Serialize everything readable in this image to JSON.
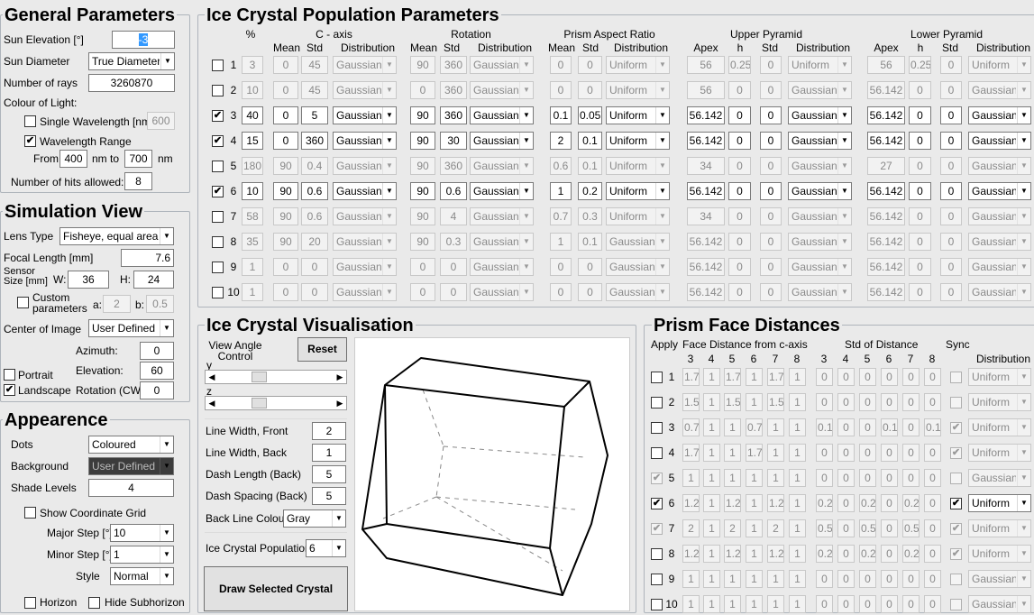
{
  "general": {
    "title": "General Parameters",
    "sun_elevation_label": "Sun Elevation [°]",
    "sun_elevation": "-3",
    "sun_diameter_label": "Sun Diameter",
    "sun_diameter": "True Diameter",
    "num_rays_label": "Number of rays",
    "num_rays": "3260870",
    "colour_label": "Colour of Light:",
    "single_wl_label": "Single Wavelength [nm]",
    "single_wl": "600",
    "single_wl_checked": "",
    "wl_range_label": "Wavelength Range",
    "wl_range_checked": "✔",
    "from_label": "From",
    "from": "400",
    "nm_to_label": "nm to",
    "to": "700",
    "nm_label": "nm",
    "hits_label": "Number of hits allowed:",
    "hits": "8"
  },
  "simview": {
    "title": "Simulation View",
    "lens_label": "Lens Type",
    "lens": "Fisheye, equal area",
    "focal_label": "Focal Length [mm]",
    "focal": "7.6",
    "sensor_label1": "Sensor",
    "sensor_label2": "Size [mm]",
    "w_label": "W:",
    "w": "36",
    "h_label": "H:",
    "h": "24",
    "custom_label1": "Custom",
    "custom_label2": "parameters",
    "custom_checked": "",
    "a_label": "a:",
    "a": "2",
    "b_label": "b:",
    "b": "0.5",
    "center_label": "Center of Image",
    "center": "User Defined",
    "azimuth_label": "Azimuth:",
    "azimuth": "0",
    "elevation_label": "Elevation:",
    "elevation": "60",
    "rotation_label": "Rotation (CW)",
    "rotation": "0",
    "portrait_label": "Portrait",
    "portrait_checked": "",
    "landscape_label": "Landscape",
    "landscape_checked": "✔"
  },
  "appearance": {
    "title": "Appearence",
    "dots_label": "Dots",
    "dots": "Coloured",
    "bg_label": "Background",
    "bg": "User Defined",
    "shade_label": "Shade Levels",
    "shade": "4",
    "grid_label": "Show Coordinate Grid",
    "grid_checked": "",
    "major_label": "Major Step [°]",
    "major": "10",
    "minor_label": "Minor Step [°]",
    "minor": "1",
    "style_label": "Style",
    "style": "Normal",
    "horizon_label": "Horizon",
    "hide_sub_label": "Hide Subhorizon"
  },
  "population": {
    "title": "Ice Crystal Population Parameters",
    "groups": {
      "pct": "%",
      "caxis": "C - axis",
      "rotation": "Rotation",
      "prism": "Prism Aspect Ratio",
      "upper": "Upper Pyramid",
      "lower": "Lower Pyramid"
    },
    "sub": {
      "mean": "Mean",
      "std": "Std",
      "dist": "Distribution",
      "apex": "Apex",
      "h": "h"
    },
    "rows": [
      {
        "n": "1",
        "chk": "",
        "pct": "3",
        "cm": "0",
        "cs": "45",
        "cd": "Gaussian",
        "rm": "90",
        "rs": "360",
        "rd": "Gaussian",
        "pm": "0",
        "ps": "0",
        "pd": "Uniform",
        "ua": "56",
        "uh": "0.25",
        "us": "0",
        "ud": "Uniform",
        "la": "56",
        "lh": "0.25",
        "ls": "0",
        "ld": "Uniform"
      },
      {
        "n": "2",
        "chk": "",
        "pct": "10",
        "cm": "0",
        "cs": "45",
        "cd": "Gaussian",
        "rm": "0",
        "rs": "360",
        "rd": "Gaussian",
        "pm": "0",
        "ps": "0",
        "pd": "Uniform",
        "ua": "56",
        "uh": "0",
        "us": "0",
        "ud": "Gaussian",
        "la": "56.142",
        "lh": "0",
        "ls": "0",
        "ld": "Gaussian"
      },
      {
        "n": "3",
        "chk": "✔",
        "pct": "40",
        "cm": "0",
        "cs": "5",
        "cd": "Gaussian",
        "rm": "90",
        "rs": "360",
        "rd": "Gaussian",
        "pm": "0.1",
        "ps": "0.05",
        "pd": "Uniform",
        "ua": "56.142",
        "uh": "0",
        "us": "0",
        "ud": "Gaussian",
        "la": "56.142",
        "lh": "0",
        "ls": "0",
        "ld": "Gaussian"
      },
      {
        "n": "4",
        "chk": "✔",
        "pct": "15",
        "cm": "0",
        "cs": "360",
        "cd": "Gaussian",
        "rm": "90",
        "rs": "30",
        "rd": "Gaussian",
        "pm": "2",
        "ps": "0.1",
        "pd": "Uniform",
        "ua": "56.142",
        "uh": "0",
        "us": "0",
        "ud": "Gaussian",
        "la": "56.142",
        "lh": "0",
        "ls": "0",
        "ld": "Gaussian"
      },
      {
        "n": "5",
        "chk": "",
        "pct": "180",
        "cm": "90",
        "cs": "0.4",
        "cd": "Gaussian",
        "rm": "90",
        "rs": "360",
        "rd": "Gaussian",
        "pm": "0.6",
        "ps": "0.1",
        "pd": "Uniform",
        "ua": "34",
        "uh": "0",
        "us": "0",
        "ud": "Gaussian",
        "la": "27",
        "lh": "0",
        "ls": "0",
        "ld": "Gaussian"
      },
      {
        "n": "6",
        "chk": "✔",
        "pct": "10",
        "cm": "90",
        "cs": "0.6",
        "cd": "Gaussian",
        "rm": "90",
        "rs": "0.6",
        "rd": "Gaussian",
        "pm": "1",
        "ps": "0.2",
        "pd": "Uniform",
        "ua": "56.142",
        "uh": "0",
        "us": "0",
        "ud": "Gaussian",
        "la": "56.142",
        "lh": "0",
        "ls": "0",
        "ld": "Gaussian"
      },
      {
        "n": "7",
        "chk": "",
        "pct": "58",
        "cm": "90",
        "cs": "0.6",
        "cd": "Gaussian",
        "rm": "90",
        "rs": "4",
        "rd": "Gaussian",
        "pm": "0.7",
        "ps": "0.3",
        "pd": "Uniform",
        "ua": "34",
        "uh": "0",
        "us": "0",
        "ud": "Gaussian",
        "la": "56.142",
        "lh": "0",
        "ls": "0",
        "ld": "Gaussian"
      },
      {
        "n": "8",
        "chk": "",
        "pct": "35",
        "cm": "90",
        "cs": "20",
        "cd": "Gaussian",
        "rm": "90",
        "rs": "0.3",
        "rd": "Gaussian",
        "pm": "1",
        "ps": "0.1",
        "pd": "Gaussian",
        "ua": "56.142",
        "uh": "0",
        "us": "0",
        "ud": "Gaussian",
        "la": "56.142",
        "lh": "0",
        "ls": "0",
        "ld": "Gaussian"
      },
      {
        "n": "9",
        "chk": "",
        "pct": "1",
        "cm": "0",
        "cs": "0",
        "cd": "Gaussian",
        "rm": "0",
        "rs": "0",
        "rd": "Gaussian",
        "pm": "0",
        "ps": "0",
        "pd": "Gaussian",
        "ua": "56.142",
        "uh": "0",
        "us": "0",
        "ud": "Gaussian",
        "la": "56.142",
        "lh": "0",
        "ls": "0",
        "ld": "Gaussian"
      },
      {
        "n": "10",
        "chk": "",
        "pct": "1",
        "cm": "0",
        "cs": "0",
        "cd": "Gaussian",
        "rm": "0",
        "rs": "0",
        "rd": "Gaussian",
        "pm": "0",
        "ps": "0",
        "pd": "Gaussian",
        "ua": "56.142",
        "uh": "0",
        "us": "0",
        "ud": "Gaussian",
        "la": "56.142",
        "lh": "0",
        "ls": "0",
        "ld": "Gaussian"
      }
    ]
  },
  "vis": {
    "title": "Ice Crystal Visualisation",
    "view_label1": "View Angle",
    "view_label2": "Control",
    "reset": "Reset",
    "y_label": "y",
    "z_label": "z",
    "lw_front_label": "Line Width, Front",
    "lw_front": "2",
    "lw_back_label": "Line Width, Back",
    "lw_back": "1",
    "dash_len_label": "Dash Length (Back)",
    "dash_len": "5",
    "dash_sp_label": "Dash Spacing (Back)",
    "dash_sp": "5",
    "back_col_label": "Back Line Colour",
    "back_col": "Gray",
    "pop_label": "Ice Crystal Population",
    "pop": "6",
    "draw": "Draw Selected Crystal",
    "y_slider": 0.33,
    "z_slider": 0.33
  },
  "prism": {
    "title": "Prism Face Distances",
    "apply": "Apply",
    "face_dist": "Face Distance from c-axis",
    "std_dist": "Std of Distance",
    "sync": "Sync",
    "distribution": "Distribution",
    "faces": [
      "3",
      "4",
      "5",
      "6",
      "7",
      "8"
    ],
    "rows": [
      {
        "n": "1",
        "apply": "",
        "fd": [
          "1.7",
          "1",
          "1.7",
          "1",
          "1.7",
          "1"
        ],
        "sd": [
          "0",
          "0",
          "0",
          "0",
          "0",
          "0"
        ],
        "sync": "",
        "sync_dis": false,
        "dist": "Uniform"
      },
      {
        "n": "2",
        "apply": "",
        "fd": [
          "1.5",
          "1",
          "1.5",
          "1",
          "1.5",
          "1"
        ],
        "sd": [
          "0",
          "0",
          "0",
          "0",
          "0",
          "0"
        ],
        "sync": "",
        "sync_dis": false,
        "dist": "Uniform"
      },
      {
        "n": "3",
        "apply": "",
        "fd": [
          "0.7",
          "1",
          "1",
          "0.7",
          "1",
          "1"
        ],
        "sd": [
          "0.1",
          "0",
          "0",
          "0.1",
          "0",
          "0.1"
        ],
        "sync": "✔",
        "sync_dis": true,
        "dist": "Uniform"
      },
      {
        "n": "4",
        "apply": "",
        "fd": [
          "1.7",
          "1",
          "1",
          "1.7",
          "1",
          "1"
        ],
        "sd": [
          "0",
          "0",
          "0",
          "0",
          "0",
          "0"
        ],
        "sync": "✔",
        "sync_dis": true,
        "dist": "Uniform"
      },
      {
        "n": "5",
        "apply": "✔",
        "fd": [
          "1",
          "1",
          "1",
          "1",
          "1",
          "1"
        ],
        "sd": [
          "0",
          "0",
          "0",
          "0",
          "0",
          "0"
        ],
        "sync": "",
        "sync_dis": false,
        "dist": "Gaussian"
      },
      {
        "n": "6",
        "apply": "✔",
        "fd": [
          "1.2",
          "1",
          "1.2",
          "1",
          "1.2",
          "1"
        ],
        "sd": [
          "0.2",
          "0",
          "0.2",
          "0",
          "0.2",
          "0"
        ],
        "sync": "✔",
        "sync_dis": false,
        "dist": "Uniform"
      },
      {
        "n": "7",
        "apply": "✔",
        "fd": [
          "2",
          "1",
          "2",
          "1",
          "2",
          "1"
        ],
        "sd": [
          "0.5",
          "0",
          "0.5",
          "0",
          "0.5",
          "0"
        ],
        "sync": "✔",
        "sync_dis": true,
        "dist": "Uniform"
      },
      {
        "n": "8",
        "apply": "",
        "fd": [
          "1.2",
          "1",
          "1.2",
          "1",
          "1.2",
          "1"
        ],
        "sd": [
          "0.2",
          "0",
          "0.2",
          "0",
          "0.2",
          "0"
        ],
        "sync": "✔",
        "sync_dis": true,
        "dist": "Uniform"
      },
      {
        "n": "9",
        "apply": "",
        "fd": [
          "1",
          "1",
          "1",
          "1",
          "1",
          "1"
        ],
        "sd": [
          "0",
          "0",
          "0",
          "0",
          "0",
          "0"
        ],
        "sync": "",
        "sync_dis": false,
        "dist": "Gaussian"
      },
      {
        "n": "10",
        "apply": "",
        "fd": [
          "1",
          "1",
          "1",
          "1",
          "1",
          "1"
        ],
        "sd": [
          "0",
          "0",
          "0",
          "0",
          "0",
          "0"
        ],
        "sync": "",
        "sync_dis": false,
        "dist": "Gaussian"
      }
    ]
  }
}
